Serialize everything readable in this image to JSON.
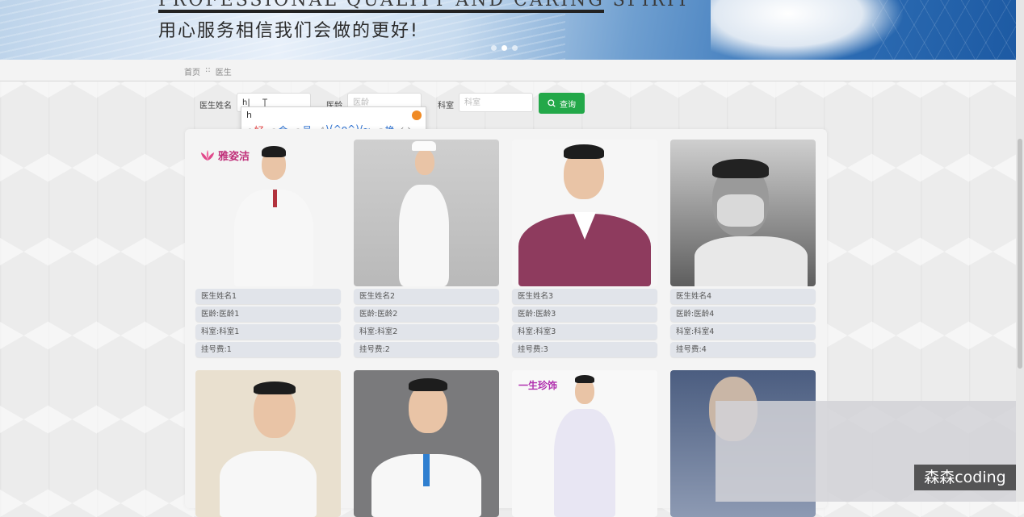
{
  "banner": {
    "english_text": "PROFESSIONAL QUALITY AND CARING SPIRIT",
    "chinese_text": "用心服务相信我们会做的更好!",
    "slide_dots": 3,
    "active_slide": 2
  },
  "breadcrumb": {
    "home": "首页",
    "separator": "::",
    "current": "医生"
  },
  "search": {
    "name_label": "医生姓名",
    "name_value": "h",
    "age_label": "医龄",
    "age_placeholder": "医龄",
    "dept_label": "科室",
    "dept_placeholder": "科室",
    "button_label": "查询"
  },
  "ime": {
    "composition": "h",
    "candidates": [
      {
        "num": "1",
        "text": "好"
      },
      {
        "num": "2",
        "text": "会"
      },
      {
        "num": "3",
        "text": "号"
      },
      {
        "num": "4",
        "text": "\\(^o^)/~"
      },
      {
        "num": "5",
        "text": "换"
      }
    ],
    "prev": "‹",
    "next": "›"
  },
  "doctors": [
    {
      "name": "医生姓名1",
      "age": "医龄:医龄1",
      "dept": "科室:科室1",
      "fee": "挂号费:1",
      "logo_text": "雅姿洁"
    },
    {
      "name": "医生姓名2",
      "age": "医龄:医龄2",
      "dept": "科室:科室2",
      "fee": "挂号费:2"
    },
    {
      "name": "医生姓名3",
      "age": "医龄:医龄3",
      "dept": "科室:科室3",
      "fee": "挂号费:3"
    },
    {
      "name": "医生姓名4",
      "age": "医龄:医龄4",
      "dept": "科室:科室4",
      "fee": "挂号费:4"
    }
  ],
  "second_row_logo_text": "一生珍饰",
  "watermark": "森森coding",
  "colors": {
    "search_button": "#23a849",
    "info_bar": "#e1e4ea",
    "ime_first": "#e23b3b",
    "ime_candidate": "#2a6fcf"
  }
}
